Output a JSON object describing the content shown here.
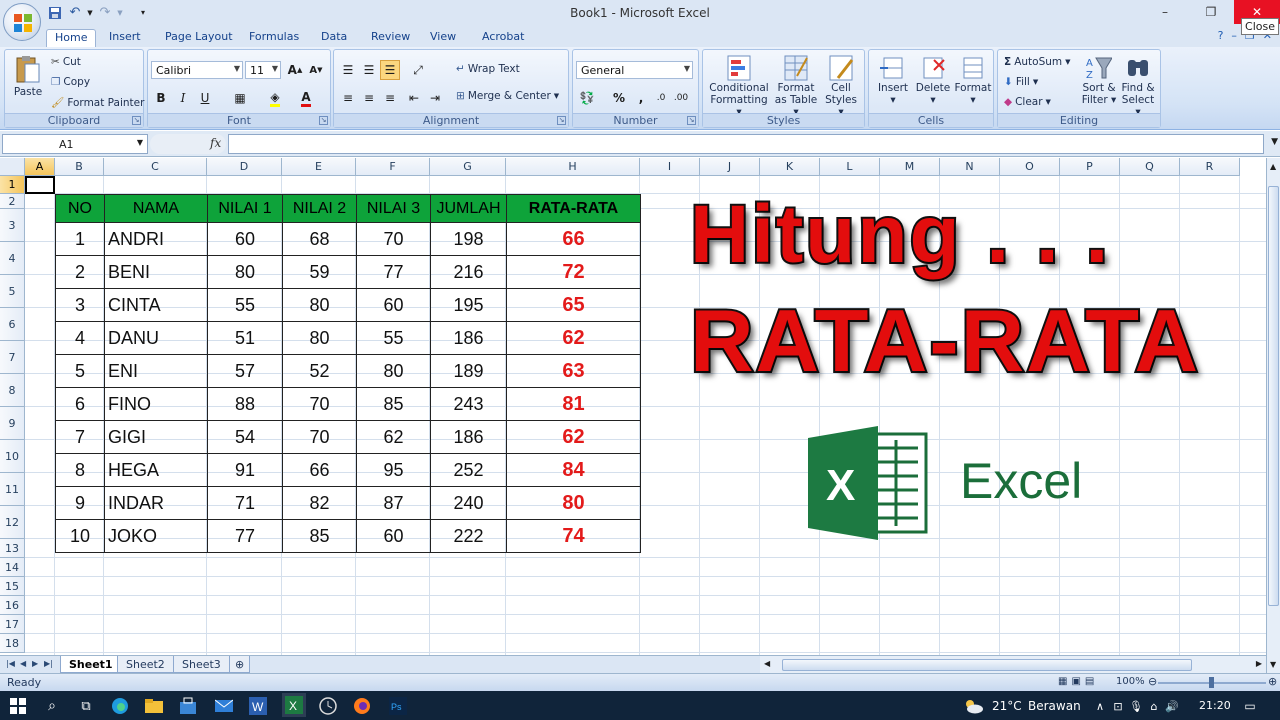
{
  "window": {
    "title": "Book1 - Microsoft Excel",
    "close_tooltip": "Close",
    "minimize": "–",
    "restore": "❐",
    "close": "✕"
  },
  "tabs": [
    "Home",
    "Insert",
    "Page Layout",
    "Formulas",
    "Data",
    "Review",
    "View",
    "Acrobat"
  ],
  "ribbon": {
    "clipboard": {
      "label": "Clipboard",
      "paste": "Paste",
      "cut": "Cut",
      "copy": "Copy",
      "format_painter": "Format Painter"
    },
    "font": {
      "label": "Font",
      "font_name": "Calibri",
      "font_size": "11",
      "bold": "B",
      "italic": "I",
      "underline": "U"
    },
    "alignment": {
      "label": "Alignment",
      "wrap_text": "Wrap Text",
      "merge_center": "Merge & Center"
    },
    "number": {
      "label": "Number",
      "format": "General",
      "percent": "%",
      "comma": ","
    },
    "styles": {
      "label": "Styles",
      "conditional": "Conditional",
      "formatting": "Formatting",
      "format": "Format",
      "as_table": "as Table",
      "cell": "Cell",
      "cell_styles": "Styles"
    },
    "cells": {
      "label": "Cells",
      "insert": "Insert",
      "delete": "Delete",
      "format": "Format"
    },
    "editing": {
      "label": "Editing",
      "autosum": "AutoSum",
      "fill": "Fill",
      "clear": "Clear",
      "sort": "Sort &",
      "filter": "Filter",
      "find": "Find &",
      "select": "Select"
    }
  },
  "formula_bar": {
    "name_box": "A1",
    "fx": "fx",
    "value": ""
  },
  "columns": [
    "A",
    "B",
    "C",
    "D",
    "E",
    "F",
    "G",
    "H",
    "I",
    "J",
    "K",
    "L",
    "M",
    "N",
    "O",
    "P",
    "Q",
    "R"
  ],
  "rows": [
    "1",
    "2",
    "3",
    "4",
    "5",
    "6",
    "7",
    "8",
    "9",
    "10",
    "11",
    "12",
    "13",
    "14",
    "15",
    "16",
    "17",
    "18"
  ],
  "table": {
    "headers": [
      "NO",
      "NAMA",
      "NILAI 1",
      "NILAI 2",
      "NILAI 3",
      "JUMLAH",
      "RATA-RATA"
    ],
    "rows": [
      [
        "1",
        "ANDRI",
        "60",
        "68",
        "70",
        "198",
        "66"
      ],
      [
        "2",
        "BENI",
        "80",
        "59",
        "77",
        "216",
        "72"
      ],
      [
        "3",
        "CINTA",
        "55",
        "80",
        "60",
        "195",
        "65"
      ],
      [
        "4",
        "DANU",
        "51",
        "80",
        "55",
        "186",
        "62"
      ],
      [
        "5",
        "ENI",
        "57",
        "52",
        "80",
        "189",
        "63"
      ],
      [
        "6",
        "FINO",
        "88",
        "70",
        "85",
        "243",
        "81"
      ],
      [
        "7",
        "GIGI",
        "54",
        "70",
        "62",
        "186",
        "62"
      ],
      [
        "8",
        "HEGA",
        "91",
        "66",
        "95",
        "252",
        "84"
      ],
      [
        "9",
        "INDAR",
        "71",
        "82",
        "87",
        "240",
        "80"
      ],
      [
        "10",
        "JOKO",
        "77",
        "85",
        "60",
        "222",
        "74"
      ]
    ]
  },
  "overlay": {
    "line1": "Hitung . . .",
    "line2": "RATA-RATA",
    "logo_word": "Excel",
    "logo_letter": "X"
  },
  "sheets": [
    "Sheet1",
    "Sheet2",
    "Sheet3"
  ],
  "status": {
    "ready": "Ready",
    "zoom": "100%"
  },
  "taskbar": {
    "temperature": "21°C",
    "condition": "Berawan",
    "time": "21:20"
  },
  "colors": {
    "header_green": "#0ea33a",
    "average_red": "#e31a1a",
    "title_red": "#e30d0d",
    "excel_green": "#1b6e3a"
  }
}
